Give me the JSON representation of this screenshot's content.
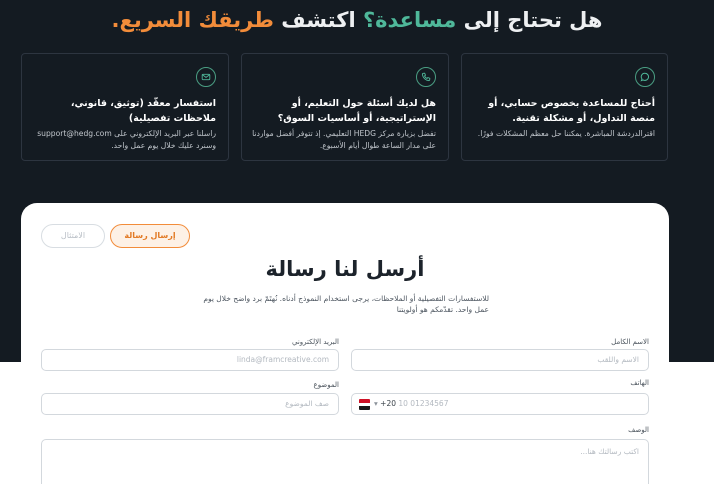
{
  "headline": {
    "part1": "هل تحتاج إلى",
    "part2": "مساعدة؟",
    "part3": "اكتشف",
    "part4": "طريقك السريع."
  },
  "cards": [
    {
      "icon": "chat-icon",
      "title": "أحتاج للمساعدة بخصوص حسابي، أو منصة التداول، أو مشكلة تقنية.",
      "desc": "اقترالدردشة المباشرة. يمكننا حل معظم المشكلات فورًا."
    },
    {
      "icon": "phone-icon",
      "title": "هل لديك أسئلة حول التعليم، أو الإستراتيجية، أو أساسيات السوق؟",
      "desc": "تفضل بزيارة مركز HEDG التعليمي. إذ تتوفر أفضل مواردنا على مدار الساعة طوال أيام الأسبوع."
    },
    {
      "icon": "mail-icon",
      "title": "استفسار معقّد (توثيق، قانوني، ملاحظات تفصيلية)",
      "desc": "راسلنا عبر البريد الإلكتروني على support@hedg.com وسنرد عليك خلال يوم عمل واحد."
    }
  ],
  "form": {
    "tabs": {
      "send": "إرسال رسالة",
      "compliance": "الامتثال"
    },
    "title": "أرسل لنا رسالة",
    "desc": "للاستفسارات التفصيلية أو الملاحظات، يرجى استخدام النموذج أدناه. نُهتَمّ برد واضح خلال يوم عمل واحد. تقدّمكم هو أولويتنا",
    "full_name": {
      "label": "الاسم الكامل",
      "placeholder": "الاسم واللقب"
    },
    "email": {
      "label": "البريد الإلكتروني",
      "placeholder": "linda@framcreative.com"
    },
    "phone": {
      "label": "الهاتف",
      "code": "+20",
      "placeholder": "10 01234567"
    },
    "subject": {
      "label": "الموضوع",
      "placeholder": "صف الموضوع"
    },
    "description": {
      "label": "الوصف",
      "placeholder": "اكتب رسالتك هنا..."
    }
  },
  "colors": {
    "dark_bg": "#141b22",
    "accent_green": "#4fb89a",
    "accent_orange": "#f28c3a"
  }
}
